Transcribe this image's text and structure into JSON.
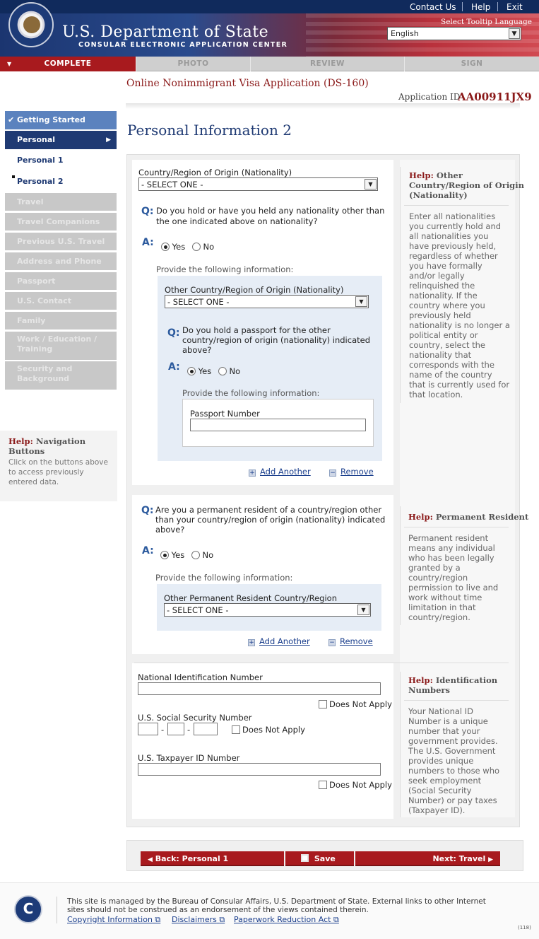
{
  "header": {
    "contact_us": "Contact Us",
    "help": "Help",
    "exit": "Exit",
    "dept_name": "U.S. Department of State",
    "dept_sub": "CONSULAR ELECTRONIC APPLICATION CENTER",
    "tooltip_label": "Select Tooltip Language",
    "language": "English"
  },
  "tabs": [
    "COMPLETE",
    "PHOTO",
    "REVIEW",
    "SIGN"
  ],
  "app": {
    "title": "Online Nonimmigrant Visa Application (DS-160)",
    "id_label": "Application ID",
    "id_value": "AA00911JX9"
  },
  "nav": {
    "getting_started": "Getting Started",
    "personal": "Personal",
    "personal1": "Personal 1",
    "personal2": "Personal 2",
    "travel": "Travel",
    "travel_companions": "Travel Companions",
    "previous_travel": "Previous U.S. Travel",
    "address_phone": "Address and Phone",
    "passport": "Passport",
    "us_contact": "U.S. Contact",
    "family": "Family",
    "work_edu_1": "Work / Education /",
    "work_edu_2": "Training",
    "security_1": "Security and",
    "security_2": "Background",
    "help_label": "Help:",
    "help_title": "Navigation Buttons",
    "help_text_1": "Click on the buttons above",
    "help_text_2": "to access previously",
    "help_text_3": "entered data."
  },
  "page_title": "Personal Information 2",
  "form": {
    "nationality_label": "Country/Region of Origin (Nationality)",
    "select_one": "- SELECT ONE -",
    "q": "Q:",
    "a": "A:",
    "yes": "Yes",
    "no": "No",
    "q1_line1": "Do you hold or have you held any nationality other than",
    "q1_line2": "the one indicated above on nationality?",
    "provide": "Provide the following information:",
    "other_nationality_label": "Other Country/Region of Origin (Nationality)",
    "q2_line1": "Do you hold a passport for the other",
    "q2_line2": "country/region of origin (nationality) indicated",
    "q2_line3": "above?",
    "passport_number_label": "Passport Number",
    "add_another": "Add Another",
    "remove": "Remove",
    "q3_line1": "Are you a permanent resident of a country/region other",
    "q3_line2": "than your country/region of origin (nationality) indicated",
    "q3_line3": "above?",
    "perm_res_label": "Other Permanent Resident Country/Region",
    "national_id_label": "National Identification Number",
    "does_not_apply": "Does Not Apply",
    "ssn_label": "U.S. Social Security Number",
    "taxpayer_label": "U.S. Taxpayer ID Number"
  },
  "help": {
    "label": "Help:",
    "nat_title_1": "Other",
    "nat_title_2": "Country/Region of Origin",
    "nat_title_3": "(Nationality)",
    "nat_text": [
      "Enter all nationalities",
      "you currently hold and",
      "all nationalities you",
      "have previously held,",
      "regardless of whether",
      "you have formally",
      "and/or legally",
      "relinquished the",
      "nationality. If the",
      "country where you",
      "previously held",
      "nationality is no longer a",
      "political entity or",
      "country, select the",
      "nationality that",
      "corresponds with the",
      "name of the country",
      "that is currently used for",
      "that location."
    ],
    "pr_title": "Permanent Resident",
    "pr_text": [
      "Permanent resident",
      "means any individual",
      "who has been legally",
      "granted by a",
      "country/region",
      "permission to live and",
      "work without time",
      "limitation in that",
      "country/region."
    ],
    "id_title_1": "Identification",
    "id_title_2": "Numbers",
    "id_text": [
      "Your National ID",
      "Number is a unique",
      "number that your",
      "government provides.",
      "The U.S. Government",
      "provides unique",
      "numbers to those who",
      "seek employment",
      "(Social Security",
      "Number) or pay taxes",
      "(Taxpayer ID)."
    ]
  },
  "buttons": {
    "back": "Back: Personal 1",
    "save": "Save",
    "next": "Next: Travel"
  },
  "footer": {
    "line1": "This site is managed by the Bureau of Consular Affairs, U.S. Department of State. External links to other Internet",
    "line2": "sites should not be construed as an endorsement of the views contained therein.",
    "copyright": "Copyright Information",
    "disclaimers": "Disclaimers",
    "paperwork": "Paperwork Reduction Act",
    "code": "(118)"
  }
}
